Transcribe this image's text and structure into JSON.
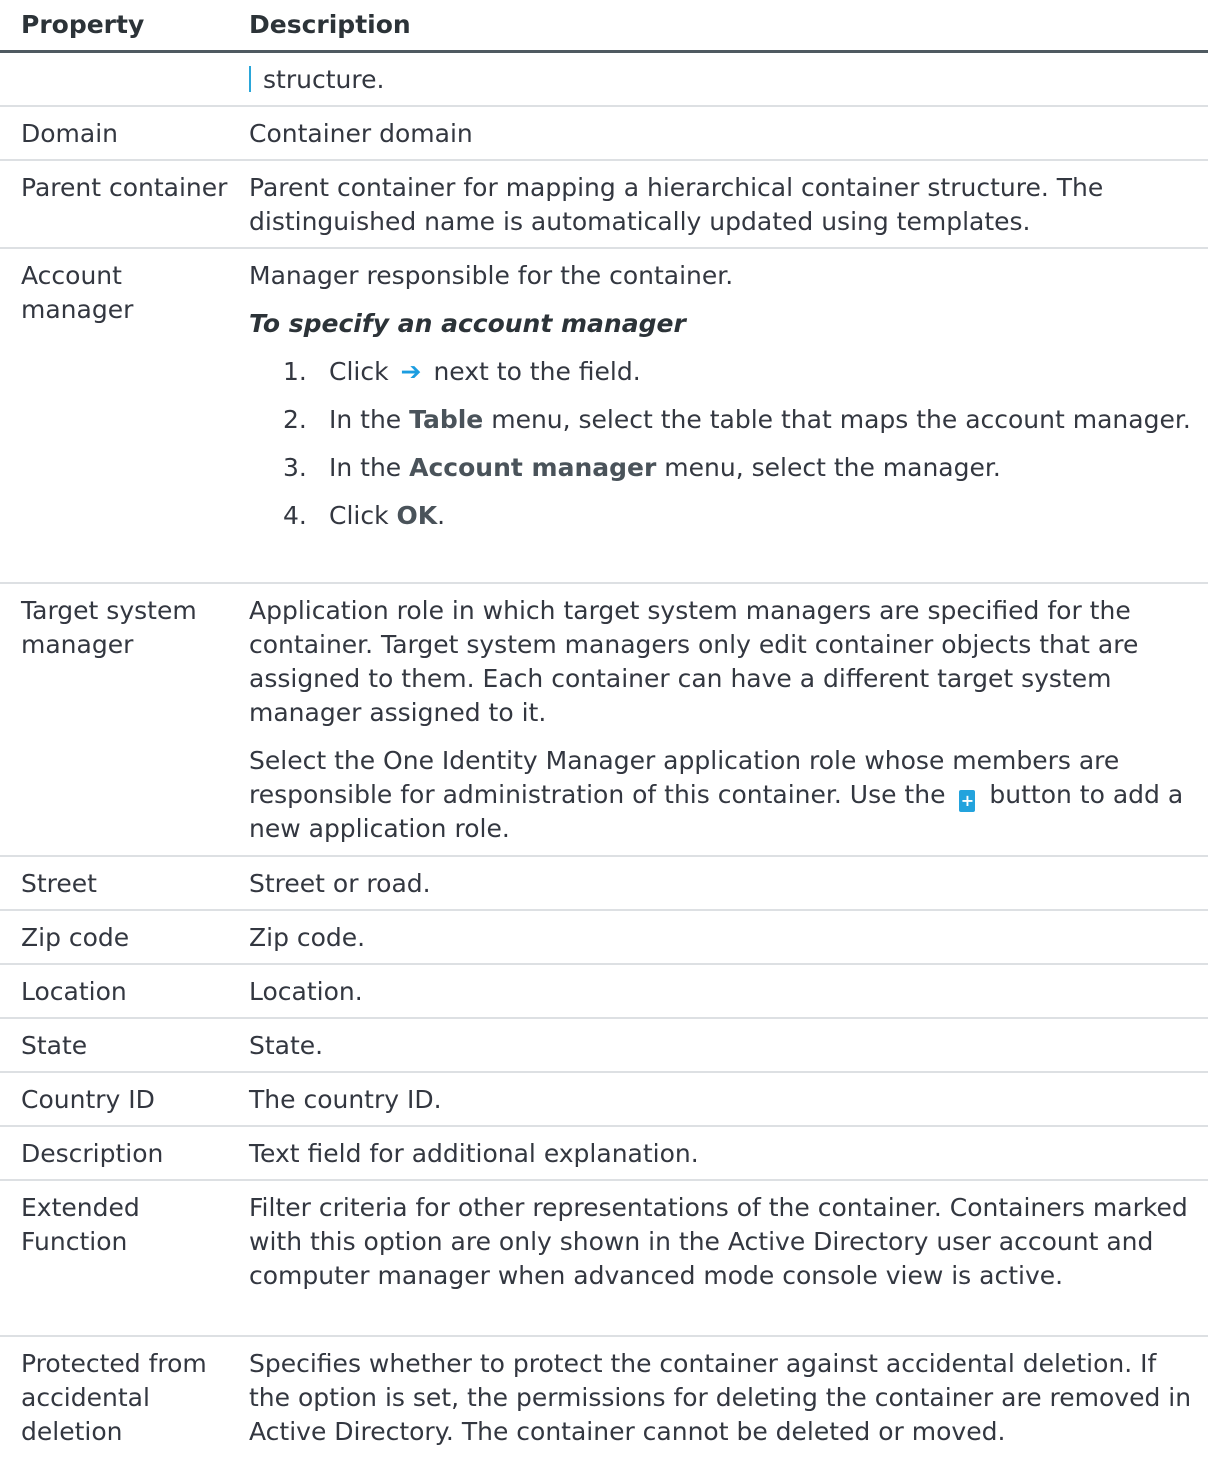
{
  "header": {
    "property": "Property",
    "description": "Description"
  },
  "rows": [
    {
      "property": "",
      "description": "structure."
    },
    {
      "property": "Domain",
      "description": "Container domain"
    },
    {
      "property": "Parent container",
      "description": "Parent container for mapping a hierarchical container structure. The distinguished name is automatically updated using templates."
    },
    {
      "property": "Account manager",
      "description": "Manager responsible for the container.",
      "procedure_title": "To specify an account manager",
      "steps": [
        {
          "num": "1.",
          "before": "Click",
          "icon": "arrow-right-icon",
          "after": "next to the field."
        },
        {
          "num": "2.",
          "before": "In the ",
          "bold": "Table",
          "after": " menu, select the table that maps the account manager."
        },
        {
          "num": "3.",
          "before": "In the ",
          "bold": "Account manager",
          "after": " menu, select the manager."
        },
        {
          "num": "4.",
          "before": "Click ",
          "bold": "OK",
          "after": "."
        }
      ]
    },
    {
      "property": "Target system manager",
      "description": "Application role in which target system managers are specified for the container. Target system managers only edit container objects that are assigned to them. Each container can have a different target system manager assigned to it.",
      "description2_before": "Select the One Identity Manager application role whose members are responsible for administration of this container. Use the",
      "description2_icon": "add-icon",
      "description2_after": "button to add a new application role."
    },
    {
      "property": "Street",
      "description": "Street or road."
    },
    {
      "property": "Zip code",
      "description": "Zip code."
    },
    {
      "property": "Location",
      "description": "Location."
    },
    {
      "property": "State",
      "description": "State."
    },
    {
      "property": "Country ID",
      "description": "The country ID."
    },
    {
      "property": "Description",
      "description": "Text field for additional explanation."
    },
    {
      "property": "Extended Function",
      "description": "Filter criteria for other representations of the container. Containers marked with this option are only shown in the Active Directory user account and computer manager when advanced mode console view is active."
    },
    {
      "property": "Protected from accidental deletion",
      "description": "Specifies whether to protect the container against accidental deletion. If the option is set, the permissions for deleting the container are removed in Active Directory. The container cannot be deleted or moved."
    }
  ]
}
